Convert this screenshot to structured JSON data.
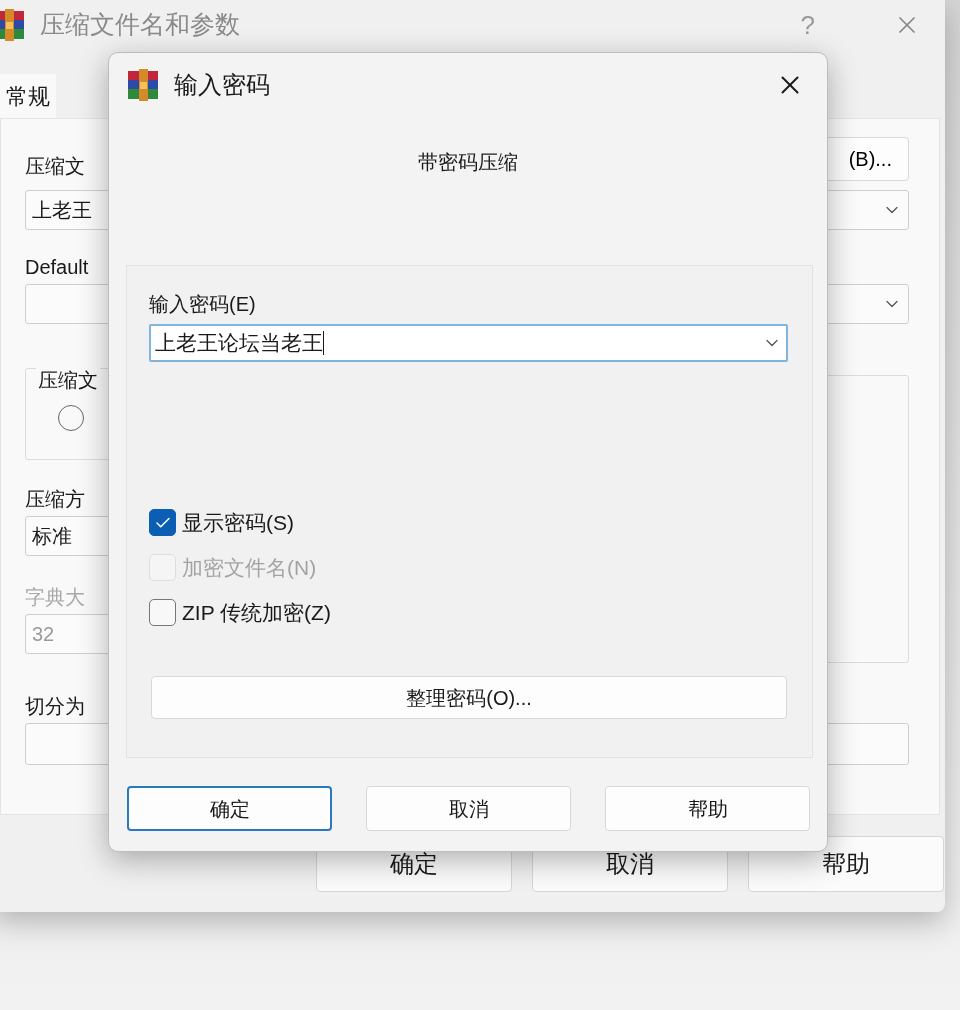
{
  "background_window": {
    "title": "压缩文件名和参数",
    "help": "?",
    "tabs": [
      {
        "label": "常规",
        "selected": true
      }
    ],
    "archive_name_label": "压缩文",
    "browse_button": "(B)...",
    "archive_name_value": "上老王",
    "profile_label": "Default",
    "format_group_label": "压缩文",
    "format_radio": {
      "selected": false
    },
    "method_label": "压缩方",
    "method_value": "标准",
    "dictionary_label": "字典大",
    "dictionary_value": "32",
    "dictionary_disabled": true,
    "split_label": "切分为",
    "buttons": [
      "确定",
      "取消",
      "帮助"
    ]
  },
  "dialog": {
    "title": "输入密码",
    "subtitle": "带密码压缩",
    "password_label": "输入密码(E)",
    "password_value": "上老王论坛当老王",
    "options": [
      {
        "label": "显示密码(S)",
        "checked": true,
        "disabled": false
      },
      {
        "label": "加密文件名(N)",
        "checked": false,
        "disabled": true
      },
      {
        "label": "ZIP 传统加密(Z)",
        "checked": false,
        "disabled": false
      }
    ],
    "organize_button": "整理密码(O)...",
    "buttons": [
      {
        "label": "确定",
        "focused": true
      },
      {
        "label": "取消",
        "focused": false
      },
      {
        "label": "帮助",
        "focused": false
      }
    ]
  }
}
